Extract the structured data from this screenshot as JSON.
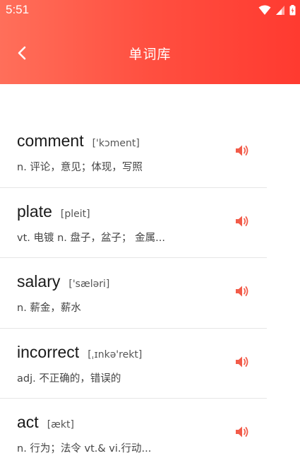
{
  "status_bar": {
    "time": "5:51",
    "icons": [
      "wifi-icon",
      "signal-icon",
      "battery-icon"
    ]
  },
  "toolbar": {
    "title": "单词库",
    "back_icon": "chevron-left-icon"
  },
  "colors": {
    "header_gradient_start": "#ff6f5a",
    "header_gradient_end": "#ff3a30",
    "speaker_accent": "#f25c4a"
  },
  "words": [
    {
      "word": "comment",
      "phonetic": "['kɔment]",
      "meaning": "n. 评论，意见；体现，写照"
    },
    {
      "word": "plate",
      "phonetic": "[pleit]",
      "meaning": "vt. 电镀  n. 盘子，盆子；  金属..."
    },
    {
      "word": "salary",
      "phonetic": "['sæləri]",
      "meaning": "n. 薪金，薪水"
    },
    {
      "word": "incorrect",
      "phonetic": "[ˌɪnkə'rekt]",
      "meaning": "adj. 不正确的，错误的"
    },
    {
      "word": "act",
      "phonetic": "[ækt]",
      "meaning": "n. 行为；法令  vt.& vi.行动..."
    }
  ]
}
